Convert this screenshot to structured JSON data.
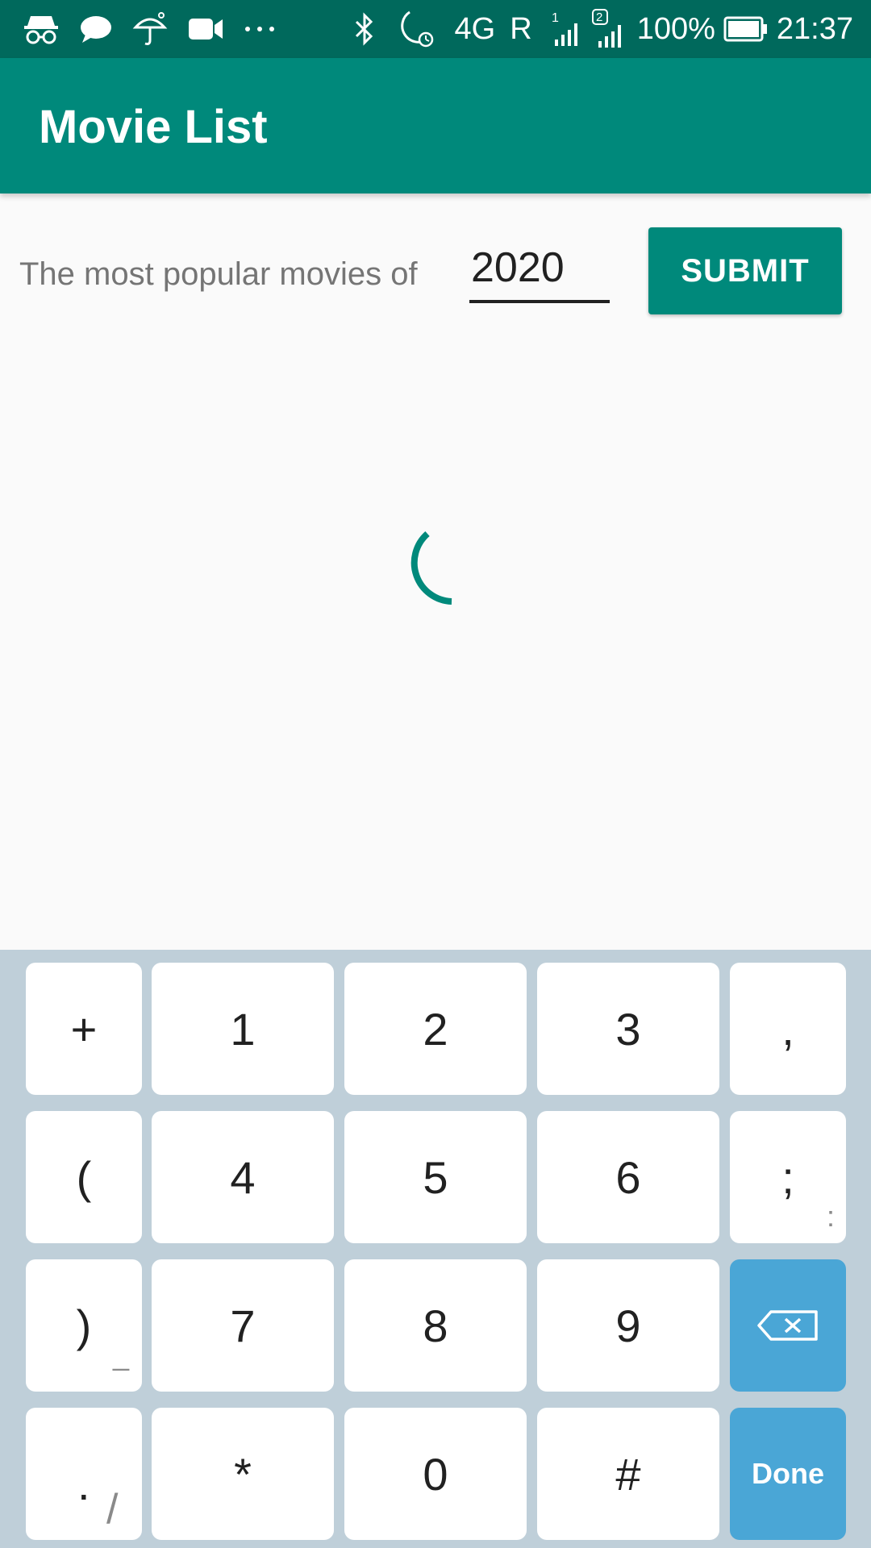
{
  "status_bar": {
    "network": "4G",
    "roaming": "R",
    "sim1_label": "1",
    "sim2_label": "2",
    "battery": "100%",
    "time": "21:37",
    "icons": [
      "incognito-icon",
      "chat-bubble-icon",
      "umbrella-icon",
      "video-camera-icon",
      "more-dots-icon",
      "bluetooth-icon",
      "moon-alarm-icon",
      "signal-icon",
      "battery-icon"
    ]
  },
  "app_bar": {
    "title": "Movie List"
  },
  "form": {
    "label": "The most popular movies of",
    "year_value": "2020",
    "submit_label": "SUBMIT"
  },
  "colors": {
    "primary": "#00897b",
    "primary_dark": "#00695c",
    "keyboard_bg": "#bfcfd9",
    "key_action": "#4aa6d6"
  },
  "keyboard": {
    "rows": [
      [
        {
          "label": "+"
        },
        {
          "label": "1"
        },
        {
          "label": "2"
        },
        {
          "label": "3"
        },
        {
          "label": ","
        }
      ],
      [
        {
          "label": "("
        },
        {
          "label": "4"
        },
        {
          "label": "5"
        },
        {
          "label": "6"
        },
        {
          "label": ";",
          "sub": ":"
        }
      ],
      [
        {
          "label": ")",
          "sub": "_"
        },
        {
          "label": "7"
        },
        {
          "label": "8"
        },
        {
          "label": "9"
        },
        {
          "label": "",
          "icon": "backspace-icon"
        }
      ],
      [
        {
          "label": ".",
          "sub": "/"
        },
        {
          "label": "*"
        },
        {
          "label": "0"
        },
        {
          "label": "#"
        },
        {
          "label": "Done"
        }
      ]
    ]
  }
}
